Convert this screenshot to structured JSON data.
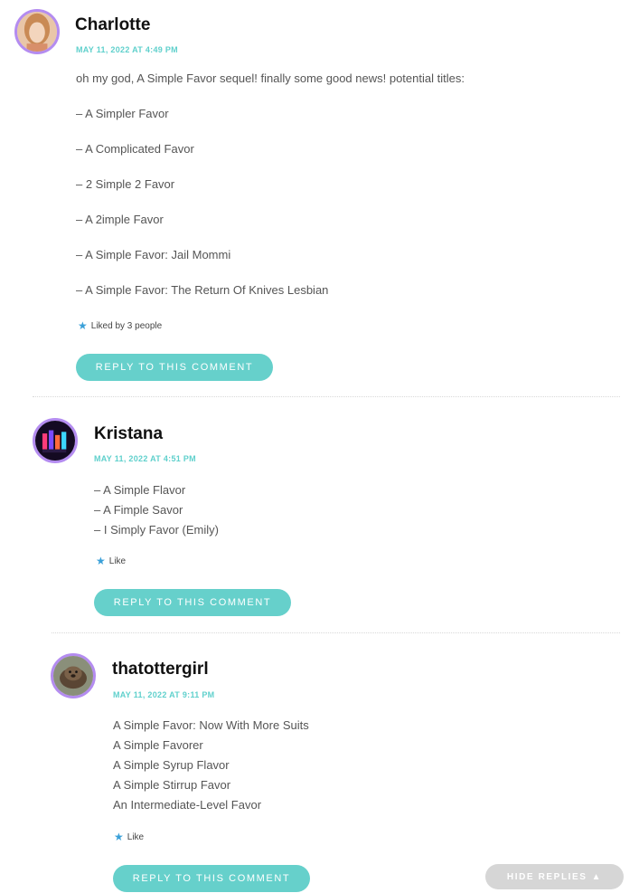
{
  "comments": [
    {
      "author": "Charlotte",
      "date": "MAY 11, 2022 AT 4:49 PM",
      "intro": "oh my god, A Simple Favor sequel! finally some good news! potential titles:",
      "lines": [
        "– A Simpler Favor",
        "– A Complicated Favor",
        "– 2 Simple 2 Favor",
        "– A 2imple Favor",
        "– A Simple Favor: Jail Mommi",
        "– A Simple Favor: The Return Of Knives Lesbian"
      ],
      "likes": "Liked by 3 people",
      "reply": "REPLY TO THIS COMMENT"
    },
    {
      "author": "Kristana",
      "date": "MAY 11, 2022 AT 4:51 PM",
      "lines": [
        "– A Simple Flavor",
        "– A Fimple Savor",
        "– I Simply Favor (Emily)"
      ],
      "likes": "Like",
      "reply": "REPLY TO THIS COMMENT"
    },
    {
      "author": "thatottergirl",
      "date": "MAY 11, 2022 AT 9:11 PM",
      "lines": [
        "A Simple Favor: Now With More Suits",
        "A Simple Favorer",
        "A Simple Syrup Flavor",
        "A Simple Stirrup Favor",
        "An Intermediate-Level Favor"
      ],
      "likes": "Like",
      "reply": "REPLY TO THIS COMMENT"
    }
  ],
  "hide_replies": {
    "label": "HIDE REPLIES",
    "icon": "triangle-up-icon"
  },
  "colors": {
    "accent": "#66d0cb",
    "date": "#5fd0cc",
    "avatar_border": "#b48cf0",
    "star": "#3aa0d8",
    "hide_button": "#d6d6d6"
  }
}
